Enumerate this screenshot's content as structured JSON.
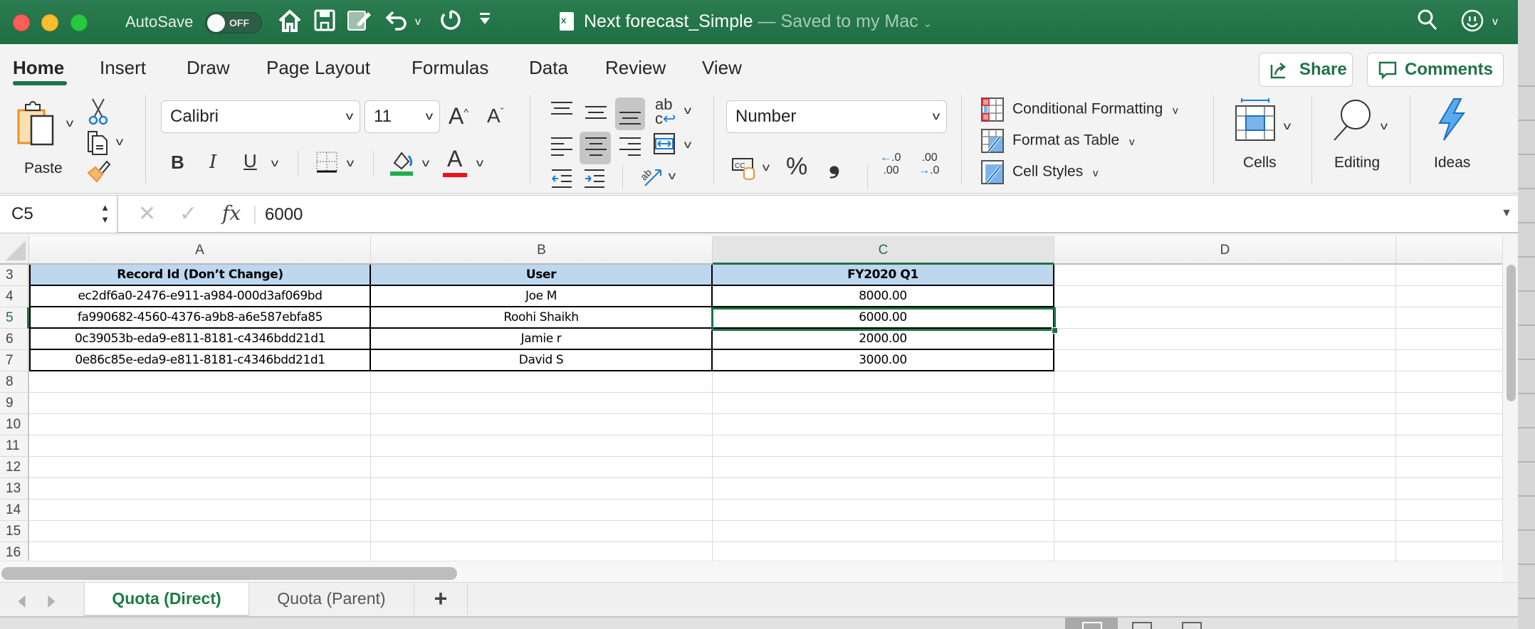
{
  "titlebar": {
    "autosave_label": "AutoSave",
    "autosave_state": "OFF",
    "doc_name": "Next forecast_Simple",
    "save_status": " — Saved to my Mac",
    "excel_badge": "X",
    "icons": [
      "home-icon",
      "save-icon",
      "edit-icon",
      "undo-icon",
      "redo-icon",
      "customize-toolbar-icon",
      "search-icon",
      "smiley-feedback-icon"
    ]
  },
  "ribbon_tabs": [
    {
      "label": "Home",
      "active": true
    },
    {
      "label": "Insert"
    },
    {
      "label": "Draw"
    },
    {
      "label": "Page Layout"
    },
    {
      "label": "Formulas"
    },
    {
      "label": "Data"
    },
    {
      "label": "Review"
    },
    {
      "label": "View"
    }
  ],
  "header_buttons": {
    "share": "Share",
    "comments": "Comments"
  },
  "ribbon": {
    "paste_label": "Paste",
    "font_name": "Calibri",
    "font_size": "11",
    "bold": "B",
    "italic": "I",
    "underline": "U",
    "font_color_glyph": "A",
    "grow_font": "A",
    "shrink_font": "A",
    "number_format": "Number",
    "percent": "%",
    "comma": "❟",
    "increase_decimal": "←.0 .00",
    "decrease_decimal": ".00 →.0",
    "conditional_formatting": "Conditional Formatting",
    "format_as_table": "Format as Table",
    "cell_styles": "Cell Styles",
    "cells": "Cells",
    "editing": "Editing",
    "ideas": "Ideas",
    "fill_color": "#1db04a",
    "font_color": "#e8141b"
  },
  "formula_bar": {
    "name_box": "C5",
    "fx": "fx",
    "value": "6000"
  },
  "grid": {
    "columns": [
      "A",
      "B",
      "C",
      "D",
      ""
    ],
    "selected_column": "C",
    "rows": [
      {
        "num": "3",
        "cells": [
          "Record Id (Don’t Change)",
          "User",
          "FY2020 Q1"
        ]
      },
      {
        "num": "4",
        "cells": [
          "ec2df6a0-2476-e911-a984-000d3af069bd",
          "Joe M",
          "8000.00"
        ]
      },
      {
        "num": "5",
        "cells": [
          "fa990682-4560-4376-a9b8-a6e587ebfa85",
          "Roohi Shaikh",
          "6000.00"
        ]
      },
      {
        "num": "6",
        "cells": [
          "0c39053b-eda9-e811-8181-c4346bdd21d1",
          "Jamie r",
          "2000.00"
        ]
      },
      {
        "num": "7",
        "cells": [
          "0e86c85e-eda9-e811-8181-c4346bdd21d1",
          "David S",
          "3000.00"
        ]
      },
      {
        "num": "8",
        "cells": []
      },
      {
        "num": "9",
        "cells": []
      },
      {
        "num": "10",
        "cells": []
      },
      {
        "num": "11",
        "cells": []
      },
      {
        "num": "12",
        "cells": []
      },
      {
        "num": "13",
        "cells": []
      },
      {
        "num": "14",
        "cells": []
      },
      {
        "num": "15",
        "cells": []
      },
      {
        "num": "16",
        "cells": []
      }
    ],
    "selected_cell": "C5",
    "selected_row": "5",
    "header_fill": "#bdd7ee",
    "accent": "#217346"
  },
  "sheets": [
    {
      "label": "Quota (Direct)",
      "active": true
    },
    {
      "label": "Quota (Parent)",
      "active": false
    }
  ],
  "add_sheet": "+"
}
